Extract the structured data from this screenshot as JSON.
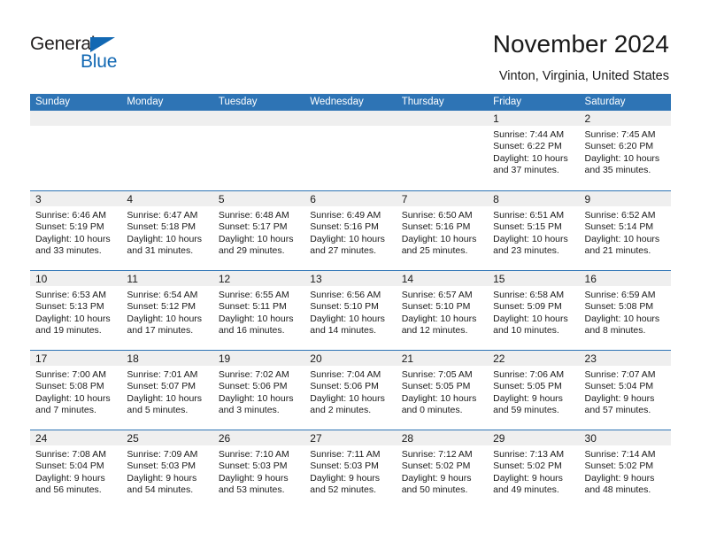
{
  "brand": {
    "name_part1": "General",
    "name_part2": "Blue",
    "accent_color": "#1268b3"
  },
  "header": {
    "title": "November 2024",
    "subtitle": "Vinton, Virginia, United States"
  },
  "theme": {
    "header_bar_color": "#2e74b5",
    "daynum_band_color": "#efefef",
    "text_color": "#1a1a1a"
  },
  "weekday_headers": [
    "Sunday",
    "Monday",
    "Tuesday",
    "Wednesday",
    "Thursday",
    "Friday",
    "Saturday"
  ],
  "labels": {
    "sunrise_prefix": "Sunrise:",
    "sunset_prefix": "Sunset:",
    "daylight_prefix": "Daylight:"
  },
  "weeks": [
    [
      {
        "day": "",
        "empty": true
      },
      {
        "day": "",
        "empty": true
      },
      {
        "day": "",
        "empty": true
      },
      {
        "day": "",
        "empty": true
      },
      {
        "day": "",
        "empty": true
      },
      {
        "day": "1",
        "sunrise": "Sunrise: 7:44 AM",
        "sunset": "Sunset: 6:22 PM",
        "daylight_1": "Daylight: 10 hours",
        "daylight_2": "and 37 minutes."
      },
      {
        "day": "2",
        "sunrise": "Sunrise: 7:45 AM",
        "sunset": "Sunset: 6:20 PM",
        "daylight_1": "Daylight: 10 hours",
        "daylight_2": "and 35 minutes."
      }
    ],
    [
      {
        "day": "3",
        "sunrise": "Sunrise: 6:46 AM",
        "sunset": "Sunset: 5:19 PM",
        "daylight_1": "Daylight: 10 hours",
        "daylight_2": "and 33 minutes."
      },
      {
        "day": "4",
        "sunrise": "Sunrise: 6:47 AM",
        "sunset": "Sunset: 5:18 PM",
        "daylight_1": "Daylight: 10 hours",
        "daylight_2": "and 31 minutes."
      },
      {
        "day": "5",
        "sunrise": "Sunrise: 6:48 AM",
        "sunset": "Sunset: 5:17 PM",
        "daylight_1": "Daylight: 10 hours",
        "daylight_2": "and 29 minutes."
      },
      {
        "day": "6",
        "sunrise": "Sunrise: 6:49 AM",
        "sunset": "Sunset: 5:16 PM",
        "daylight_1": "Daylight: 10 hours",
        "daylight_2": "and 27 minutes."
      },
      {
        "day": "7",
        "sunrise": "Sunrise: 6:50 AM",
        "sunset": "Sunset: 5:16 PM",
        "daylight_1": "Daylight: 10 hours",
        "daylight_2": "and 25 minutes."
      },
      {
        "day": "8",
        "sunrise": "Sunrise: 6:51 AM",
        "sunset": "Sunset: 5:15 PM",
        "daylight_1": "Daylight: 10 hours",
        "daylight_2": "and 23 minutes."
      },
      {
        "day": "9",
        "sunrise": "Sunrise: 6:52 AM",
        "sunset": "Sunset: 5:14 PM",
        "daylight_1": "Daylight: 10 hours",
        "daylight_2": "and 21 minutes."
      }
    ],
    [
      {
        "day": "10",
        "sunrise": "Sunrise: 6:53 AM",
        "sunset": "Sunset: 5:13 PM",
        "daylight_1": "Daylight: 10 hours",
        "daylight_2": "and 19 minutes."
      },
      {
        "day": "11",
        "sunrise": "Sunrise: 6:54 AM",
        "sunset": "Sunset: 5:12 PM",
        "daylight_1": "Daylight: 10 hours",
        "daylight_2": "and 17 minutes."
      },
      {
        "day": "12",
        "sunrise": "Sunrise: 6:55 AM",
        "sunset": "Sunset: 5:11 PM",
        "daylight_1": "Daylight: 10 hours",
        "daylight_2": "and 16 minutes."
      },
      {
        "day": "13",
        "sunrise": "Sunrise: 6:56 AM",
        "sunset": "Sunset: 5:10 PM",
        "daylight_1": "Daylight: 10 hours",
        "daylight_2": "and 14 minutes."
      },
      {
        "day": "14",
        "sunrise": "Sunrise: 6:57 AM",
        "sunset": "Sunset: 5:10 PM",
        "daylight_1": "Daylight: 10 hours",
        "daylight_2": "and 12 minutes."
      },
      {
        "day": "15",
        "sunrise": "Sunrise: 6:58 AM",
        "sunset": "Sunset: 5:09 PM",
        "daylight_1": "Daylight: 10 hours",
        "daylight_2": "and 10 minutes."
      },
      {
        "day": "16",
        "sunrise": "Sunrise: 6:59 AM",
        "sunset": "Sunset: 5:08 PM",
        "daylight_1": "Daylight: 10 hours",
        "daylight_2": "and 8 minutes."
      }
    ],
    [
      {
        "day": "17",
        "sunrise": "Sunrise: 7:00 AM",
        "sunset": "Sunset: 5:08 PM",
        "daylight_1": "Daylight: 10 hours",
        "daylight_2": "and 7 minutes."
      },
      {
        "day": "18",
        "sunrise": "Sunrise: 7:01 AM",
        "sunset": "Sunset: 5:07 PM",
        "daylight_1": "Daylight: 10 hours",
        "daylight_2": "and 5 minutes."
      },
      {
        "day": "19",
        "sunrise": "Sunrise: 7:02 AM",
        "sunset": "Sunset: 5:06 PM",
        "daylight_1": "Daylight: 10 hours",
        "daylight_2": "and 3 minutes."
      },
      {
        "day": "20",
        "sunrise": "Sunrise: 7:04 AM",
        "sunset": "Sunset: 5:06 PM",
        "daylight_1": "Daylight: 10 hours",
        "daylight_2": "and 2 minutes."
      },
      {
        "day": "21",
        "sunrise": "Sunrise: 7:05 AM",
        "sunset": "Sunset: 5:05 PM",
        "daylight_1": "Daylight: 10 hours",
        "daylight_2": "and 0 minutes."
      },
      {
        "day": "22",
        "sunrise": "Sunrise: 7:06 AM",
        "sunset": "Sunset: 5:05 PM",
        "daylight_1": "Daylight: 9 hours",
        "daylight_2": "and 59 minutes."
      },
      {
        "day": "23",
        "sunrise": "Sunrise: 7:07 AM",
        "sunset": "Sunset: 5:04 PM",
        "daylight_1": "Daylight: 9 hours",
        "daylight_2": "and 57 minutes."
      }
    ],
    [
      {
        "day": "24",
        "sunrise": "Sunrise: 7:08 AM",
        "sunset": "Sunset: 5:04 PM",
        "daylight_1": "Daylight: 9 hours",
        "daylight_2": "and 56 minutes."
      },
      {
        "day": "25",
        "sunrise": "Sunrise: 7:09 AM",
        "sunset": "Sunset: 5:03 PM",
        "daylight_1": "Daylight: 9 hours",
        "daylight_2": "and 54 minutes."
      },
      {
        "day": "26",
        "sunrise": "Sunrise: 7:10 AM",
        "sunset": "Sunset: 5:03 PM",
        "daylight_1": "Daylight: 9 hours",
        "daylight_2": "and 53 minutes."
      },
      {
        "day": "27",
        "sunrise": "Sunrise: 7:11 AM",
        "sunset": "Sunset: 5:03 PM",
        "daylight_1": "Daylight: 9 hours",
        "daylight_2": "and 52 minutes."
      },
      {
        "day": "28",
        "sunrise": "Sunrise: 7:12 AM",
        "sunset": "Sunset: 5:02 PM",
        "daylight_1": "Daylight: 9 hours",
        "daylight_2": "and 50 minutes."
      },
      {
        "day": "29",
        "sunrise": "Sunrise: 7:13 AM",
        "sunset": "Sunset: 5:02 PM",
        "daylight_1": "Daylight: 9 hours",
        "daylight_2": "and 49 minutes."
      },
      {
        "day": "30",
        "sunrise": "Sunrise: 7:14 AM",
        "sunset": "Sunset: 5:02 PM",
        "daylight_1": "Daylight: 9 hours",
        "daylight_2": "and 48 minutes."
      }
    ]
  ]
}
